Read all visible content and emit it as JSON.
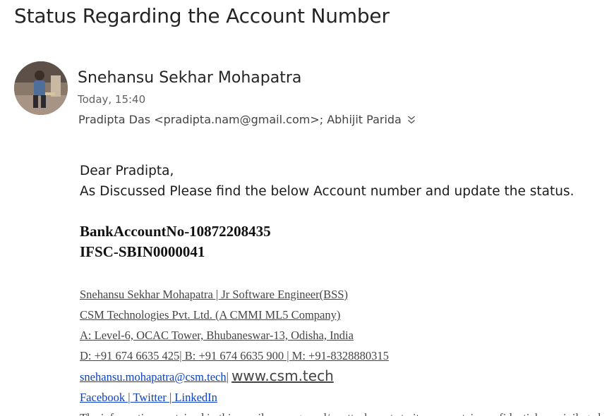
{
  "email": {
    "subject": "Status Regarding the Account Number",
    "sender_name": "Snehansu Sekhar Mohapatra",
    "date": "Today, 15:40",
    "recipients": "Pradipta Das <pradipta.nam@gmail.com>; Abhijit Parida"
  },
  "body": {
    "greeting": "Dear Pradipta,",
    "message": "As Discussed Please find the below Account number and update the status.",
    "account_line": "BankAccountNo-10872208435",
    "ifsc_line": "IFSC-SBIN0000041"
  },
  "signature": {
    "name_title": "Snehansu Sekhar Mohapatra | Jr Software Engineer(BSS) ",
    "company": "CSM Technologies Pvt. Ltd. (A CMMI ML5 Company)",
    "address": "A: Level-6, OCAC Tower, Bhubaneswar-13, Odisha, India",
    "phones": "D: +91 674 6635 425| B: +91 674 6635 900 | M: +91-8328880315",
    "email": "snehansu.mohapatra@csm.tech",
    "separator": "| ",
    "website": "www.csm.tech",
    "facebook": "Facebook ",
    "twitter": " Twitter ",
    "linkedin": " LinkedIn",
    "pipe": "|",
    "disclaimer_cut": "The information contained in this email message and/or attachments to it may contain confidential or privileged"
  },
  "icons": {
    "expand": "chevron-double-down-icon",
    "avatar": "sender-avatar"
  }
}
